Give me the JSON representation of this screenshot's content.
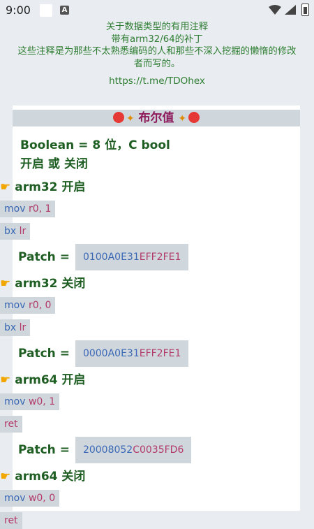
{
  "status": {
    "time": "9:00",
    "a_icon": "A"
  },
  "header": {
    "line1": "关于数据类型的有用注释",
    "line2": "带有arm32/64的补丁",
    "line3": "这些注释是为那些不太熟悉编码的人和那些不深入挖掘的懒惰的修改",
    "line4": "者而写的。",
    "link": "https://t.me/TDOhex"
  },
  "card": {
    "title": "布尔值",
    "desc_line1": "Boolean = 8 位，C bool",
    "desc_line2": "开启 或 关闭",
    "patch_label": "Patch =",
    "sections": [
      {
        "heading": "arm32 开启",
        "code1": {
          "op": "mov",
          "args": "r0, 1"
        },
        "code2": {
          "op": "bx",
          "args": "lr"
        },
        "patch_a": "0100A0E31",
        "patch_b": "EFF2FE1"
      },
      {
        "heading": "arm32 关闭",
        "code1": {
          "op": "mov",
          "args": "r0, 0"
        },
        "code2": {
          "op": "bx",
          "args": "lr"
        },
        "patch_a": "0000A0E31",
        "patch_b": "EFF2FE1"
      },
      {
        "heading": "arm64 开启",
        "code1": {
          "op": "mov",
          "args": "w0, 1"
        },
        "code2": {
          "op": "",
          "args": "ret"
        },
        "patch_a": "20008052",
        "patch_b": "C0035FD6"
      },
      {
        "heading": "arm64 关闭",
        "code1": {
          "op": "mov",
          "args": "w0, 0"
        },
        "code2": {
          "op": "",
          "args": "ret"
        }
      }
    ]
  },
  "icons": [
    "wifi-icon",
    "signal-icon",
    "battery-icon",
    "red-circle-icon",
    "butterfly-icon",
    "pointing-hand-icon"
  ],
  "colors": {
    "accent_green": "#2e7d32",
    "title_purple": "#8e1a5b",
    "code_blue": "#3a68b5",
    "code_pink": "#b23a6b",
    "code_bg": "#cfd6dc"
  }
}
